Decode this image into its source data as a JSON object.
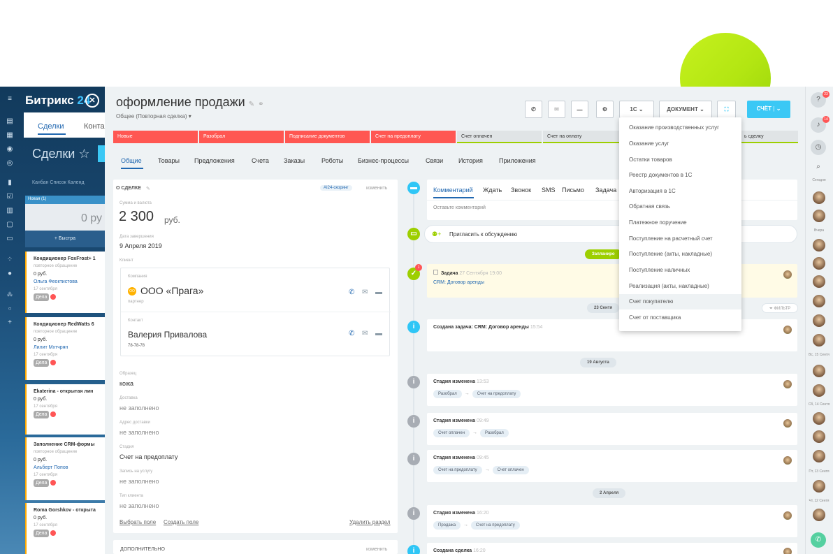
{
  "left": {
    "brand_prefix": "Битрикс",
    "brand_num": "24",
    "tab_deals": "Сделки",
    "tab_contacts": "Конта",
    "title": "Сделки ☆",
    "views": "Канбан  Список  Календ",
    "stage_new": "Новая (1)",
    "sum": "0 ру",
    "quick": "+  Быстра",
    "cards": [
      {
        "title": "Кондиционер FoxFrost+ 1",
        "type": "повторное обращение",
        "price": "0 руб.",
        "person": "Ольга Феоктистова",
        "date": "17 сентября",
        "deals": "Дела",
        "count": "1"
      },
      {
        "title": "Кондиционер RedWatts 6",
        "type": "повторное обращение",
        "price": "0 руб.",
        "person": "Лилит Мхтчрян",
        "date": "17 сентября",
        "deals": "Дела",
        "count": "1"
      },
      {
        "title": "Ekaterina - открытая лин",
        "type": "",
        "price": "0 руб.",
        "person": "",
        "date": "17 сентября",
        "deals": "Дела",
        "count": "1"
      },
      {
        "title": "Заполнение CRM-формы",
        "type": "повторное обращение",
        "price": "0 руб.",
        "person": "Альберт Попов",
        "date": "17 сентября",
        "deals": "Дела",
        "count": "1"
      },
      {
        "title": "Roma Gorshkov - открыта",
        "type": "",
        "price": "0 руб.",
        "person": "",
        "date": "17 сентября",
        "deals": "Дела",
        "count": "1"
      }
    ]
  },
  "header": {
    "title": "оформление продажи",
    "subtitle": "Общее (Повторная сделка) ▾",
    "btn_1c": "1С",
    "btn_doc": "ДОКУМЕНТ",
    "btn_check": "СЧЁТ"
  },
  "stages": [
    "Новые",
    "Разобрал",
    "Подписание документов",
    "Счет на предоплату",
    "Счет оплачен",
    "Счет на оплату",
    "ь сделку"
  ],
  "tabs": [
    "Общие",
    "Товары",
    "Предложения",
    "Счета",
    "Заказы",
    "Роботы",
    "Бизнес-процессы",
    "Связи",
    "История",
    "Приложения"
  ],
  "about": {
    "section": "О СДЕЛКЕ",
    "scoring": "AI24-скоринг",
    "edit": "изменить",
    "sum_label": "Сумма и валюта",
    "sum_value": "2 300",
    "currency": "руб.",
    "date_label": "Дата завершения",
    "date_value": "9 Апреля 2019",
    "client_label": "Клиент",
    "company_label": "Компания",
    "company_badge": "ОО",
    "company_name": "ООО «Прага»",
    "company_role": "партнер",
    "contact_label": "Контакт",
    "contact_name": "Валерия Привалова",
    "contact_phone": "78-78-78",
    "fields": [
      {
        "label": "Образец",
        "value": "кожа"
      },
      {
        "label": "Доставка",
        "value": "не заполнено"
      },
      {
        "label": "Адрес доставки",
        "value": "не заполнено"
      },
      {
        "label": "Стадия",
        "value": "Счет на предоплату"
      },
      {
        "label": "Запись на услугу",
        "value": "не заполнено"
      },
      {
        "label": "Тип клиента",
        "value": "не заполнено"
      }
    ],
    "choose_field": "Выбрать поле",
    "create_field": "Создать поле",
    "delete_section": "Удалить раздел",
    "extra_section": "ДОПОЛНИТЕЛЬНО",
    "extra_edit": "изменить"
  },
  "timeline": {
    "tabs": [
      "Комментарий",
      "Ждать",
      "Звонок",
      "SMS",
      "Письмо",
      "Задача"
    ],
    "comment_placeholder": "Оставьте комментарий",
    "invite": "Пригласить к обсуждению",
    "planned_badge": "Запланиро",
    "task_label": "Задача",
    "task_time": "27 Сентября 19:00",
    "task_link": "CRM: Договор аренды",
    "date1": "23 Сентя",
    "filter": "ФИЛЬТР",
    "created_task": "Создана задача: CRM: Договор аренды",
    "created_task_time": "15:54",
    "date2": "19 Августа",
    "events": [
      {
        "title": "Стадия изменена",
        "time": "13:53",
        "from": "Разобрал",
        "to": "Счет на предоплату"
      },
      {
        "title": "Стадия изменена",
        "time": "09:49",
        "from": "Счет оплачен",
        "to": "Разобрал"
      },
      {
        "title": "Стадия изменена",
        "time": "09:45",
        "from": "Счет на предоплату",
        "to": "Счет оплачен"
      }
    ],
    "date3": "2 Апреля",
    "event4": {
      "title": "Стадия изменена",
      "time": "16:20",
      "from": "Продажа",
      "to": "Счет на предоплату"
    },
    "created_deal": "Создана сделка",
    "created_deal_time": "16:20"
  },
  "dropdown": {
    "items": [
      "Оказание производственных услуг",
      "Оказание услуг",
      "Остатки товаров",
      "Реестр документов в 1С",
      "Авторизация в 1С",
      "Обратная связь",
      "Платежное поручение",
      "Поступление на расчетный счет",
      "Поступление (акты, накладные)",
      "Поступление наличных",
      "Реализация (акты, накладные)",
      "Счет покупателю",
      "Счет от поставщика"
    ],
    "highlighted": "Счет покупателю"
  },
  "rightbar": {
    "badge1": "23",
    "badge2": "14",
    "today": "Сегодня",
    "yesterday": "Вчера",
    "d1": "Вс, 15 Сентя",
    "d2": "Сб, 14 Сентя",
    "d3": "Пт, 13 Сентя",
    "d4": "Чт, 12 Сентя"
  },
  "colors": {
    "accent": "#3bc8f5",
    "stage_red": "#ff5752",
    "link": "#2067b0",
    "deco": "#b3e612"
  }
}
